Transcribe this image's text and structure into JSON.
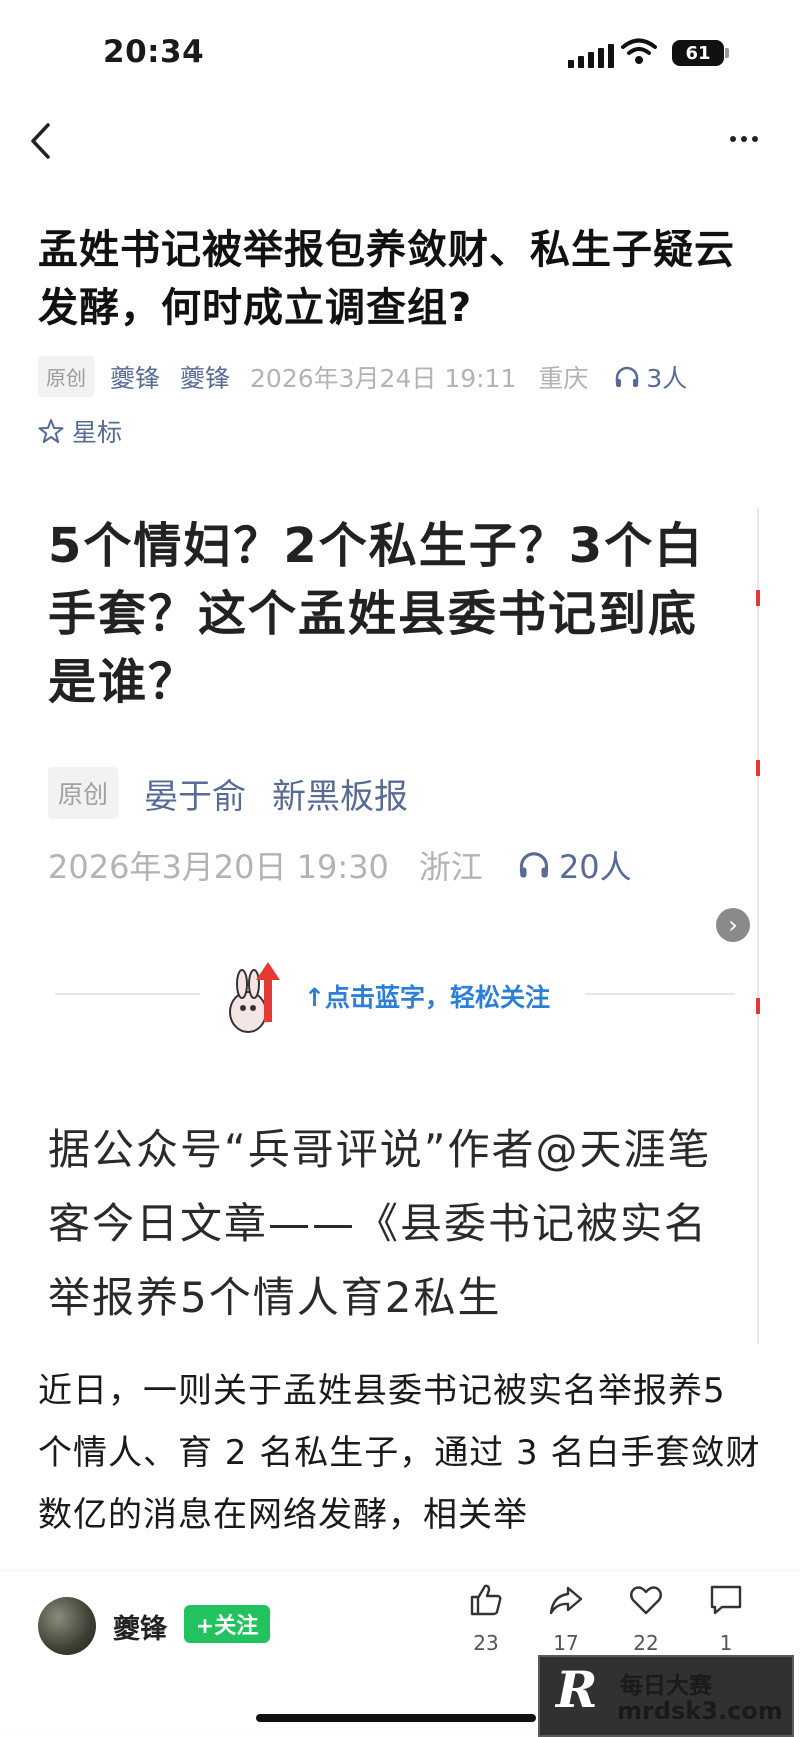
{
  "status_bar": {
    "time": "20:34",
    "battery": "61"
  },
  "article": {
    "title": "孟姓书记被举报包养敛财、私生子疑云发酵，何时成立调查组?",
    "tag": "原创",
    "author": "夔锋",
    "account": "夔锋",
    "date": "2026年3月24日 19:11",
    "location": "重庆",
    "listeners": "3人",
    "star_label": "星标",
    "body": "近日，一则关于孟姓县委书记被实名举报养5 个情人、育 2 名私生子，通过 3 名白手套敛财数亿的消息在网络发酵，相关举"
  },
  "embedded": {
    "title": "5个情妇？2个私生子？3个白手套？这个孟姓县委书记到底是谁？",
    "tag": "原创",
    "author": "晏于俞",
    "account": "新黑板报",
    "date": "2026年3月20日 19:30",
    "location": "浙江",
    "listeners": "20人",
    "follow_hint": "↑点击蓝字，轻松关注",
    "body": "据公众号“兵哥评说”作者@天涯笔客今日文章——《县委书记被实名举报养5个情人育2私生"
  },
  "bottom_bar": {
    "author": "夔锋",
    "follow_label": "+关注",
    "likes": "23",
    "shares": "17",
    "favorites": "22",
    "comments": "1"
  },
  "watermark": {
    "line1": "每日大赛",
    "line2": "mrdsk3.com",
    "logo": "R"
  },
  "colors": {
    "link": "#576b95",
    "follow_green": "#22c35e",
    "hint_blue": "#2b7fd9"
  }
}
